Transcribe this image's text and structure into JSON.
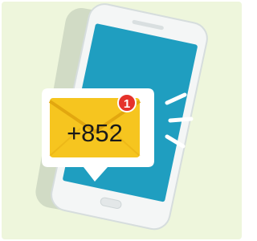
{
  "illustration": {
    "notification_text": "+852",
    "badge_count": "1"
  },
  "colors": {
    "background": "#eef6dc",
    "phone_body": "#f4f6f6",
    "phone_outline": "#d6dddd",
    "screen": "#1f9ec0",
    "shadow": "#b9c4b2",
    "bubble": "#ffffff",
    "envelope": "#f6c51f",
    "envelope_dark": "#e2a70f",
    "badge": "#e5322b",
    "ring_lines": "#ffffff"
  },
  "icons": [
    "smartphone-icon",
    "envelope-icon",
    "notification-badge-icon",
    "ringing-lines-icon"
  ]
}
